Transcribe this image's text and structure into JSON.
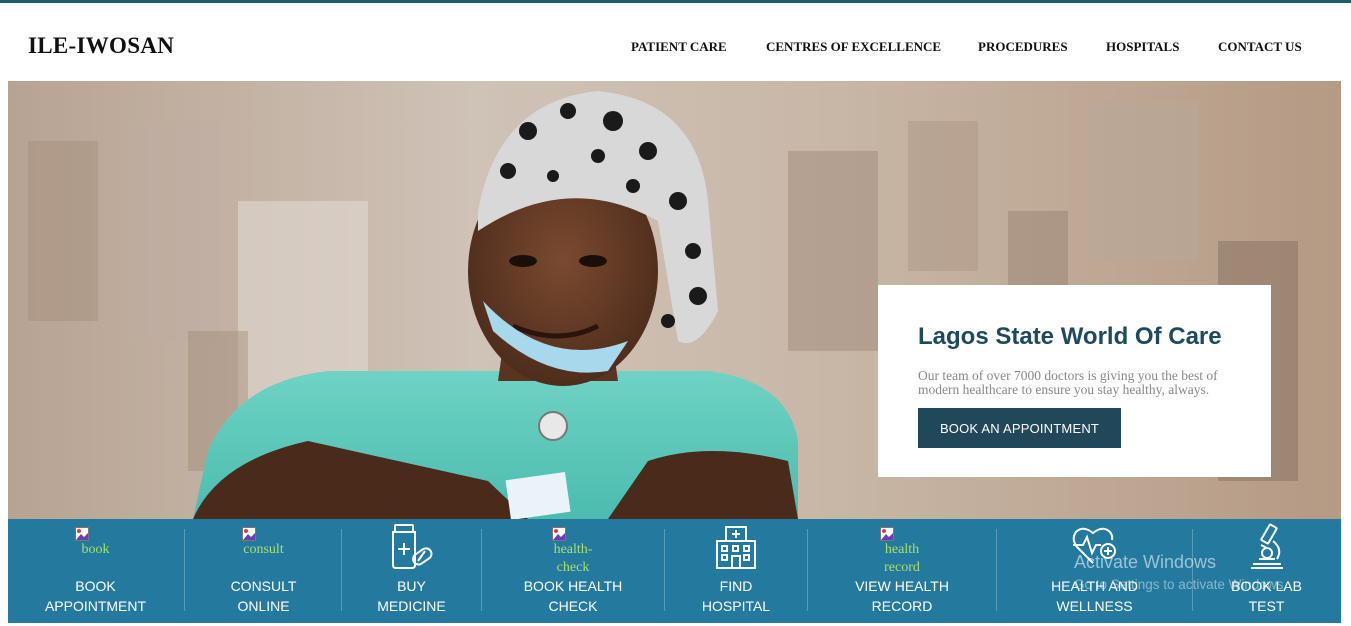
{
  "brand": "ILE-IWOSAN",
  "nav": [
    "PATIENT CARE",
    "CENTRES OF EXCELLENCE",
    "PROCEDURES",
    "HOSPITALS",
    "CONTACT US"
  ],
  "hero": {
    "card_title": "Lagos State World Of Care",
    "card_text": "Our team of over 7000 doctors is giving you the best of modern healthcare to ensure you stay healthy, always.",
    "button": "BOOK AN APPOINTMENT"
  },
  "quick_links": [
    {
      "alt": "book",
      "label": "BOOK APPOINTMENT",
      "icon": "broken-image-icon"
    },
    {
      "alt": "consult",
      "label": "CONSULT ONLINE",
      "icon": "broken-image-icon"
    },
    {
      "alt": "",
      "label": "BUY MEDICINE",
      "icon": "medicine-bottle-icon"
    },
    {
      "alt": "health-check",
      "label": "BOOK HEALTH CHECK",
      "icon": "broken-image-icon"
    },
    {
      "alt": "",
      "label": "FIND HOSPITAL",
      "icon": "hospital-building-icon"
    },
    {
      "alt": "health record",
      "label": "VIEW HEALTH RECORD",
      "icon": "broken-image-icon"
    },
    {
      "alt": "",
      "label": "HEALTH AND WELLNESS",
      "icon": "heart-plus-icon"
    },
    {
      "alt": "",
      "label": "BOOK LAB TEST",
      "icon": "microscope-icon"
    }
  ],
  "watermark": {
    "line1": "Activate Windows",
    "line2": "Go to Settings to activate Windows."
  },
  "colors": {
    "accent": "#237a9e",
    "button": "#21475a",
    "title": "#1f4a5b",
    "alt_text": "#a8e06a"
  }
}
